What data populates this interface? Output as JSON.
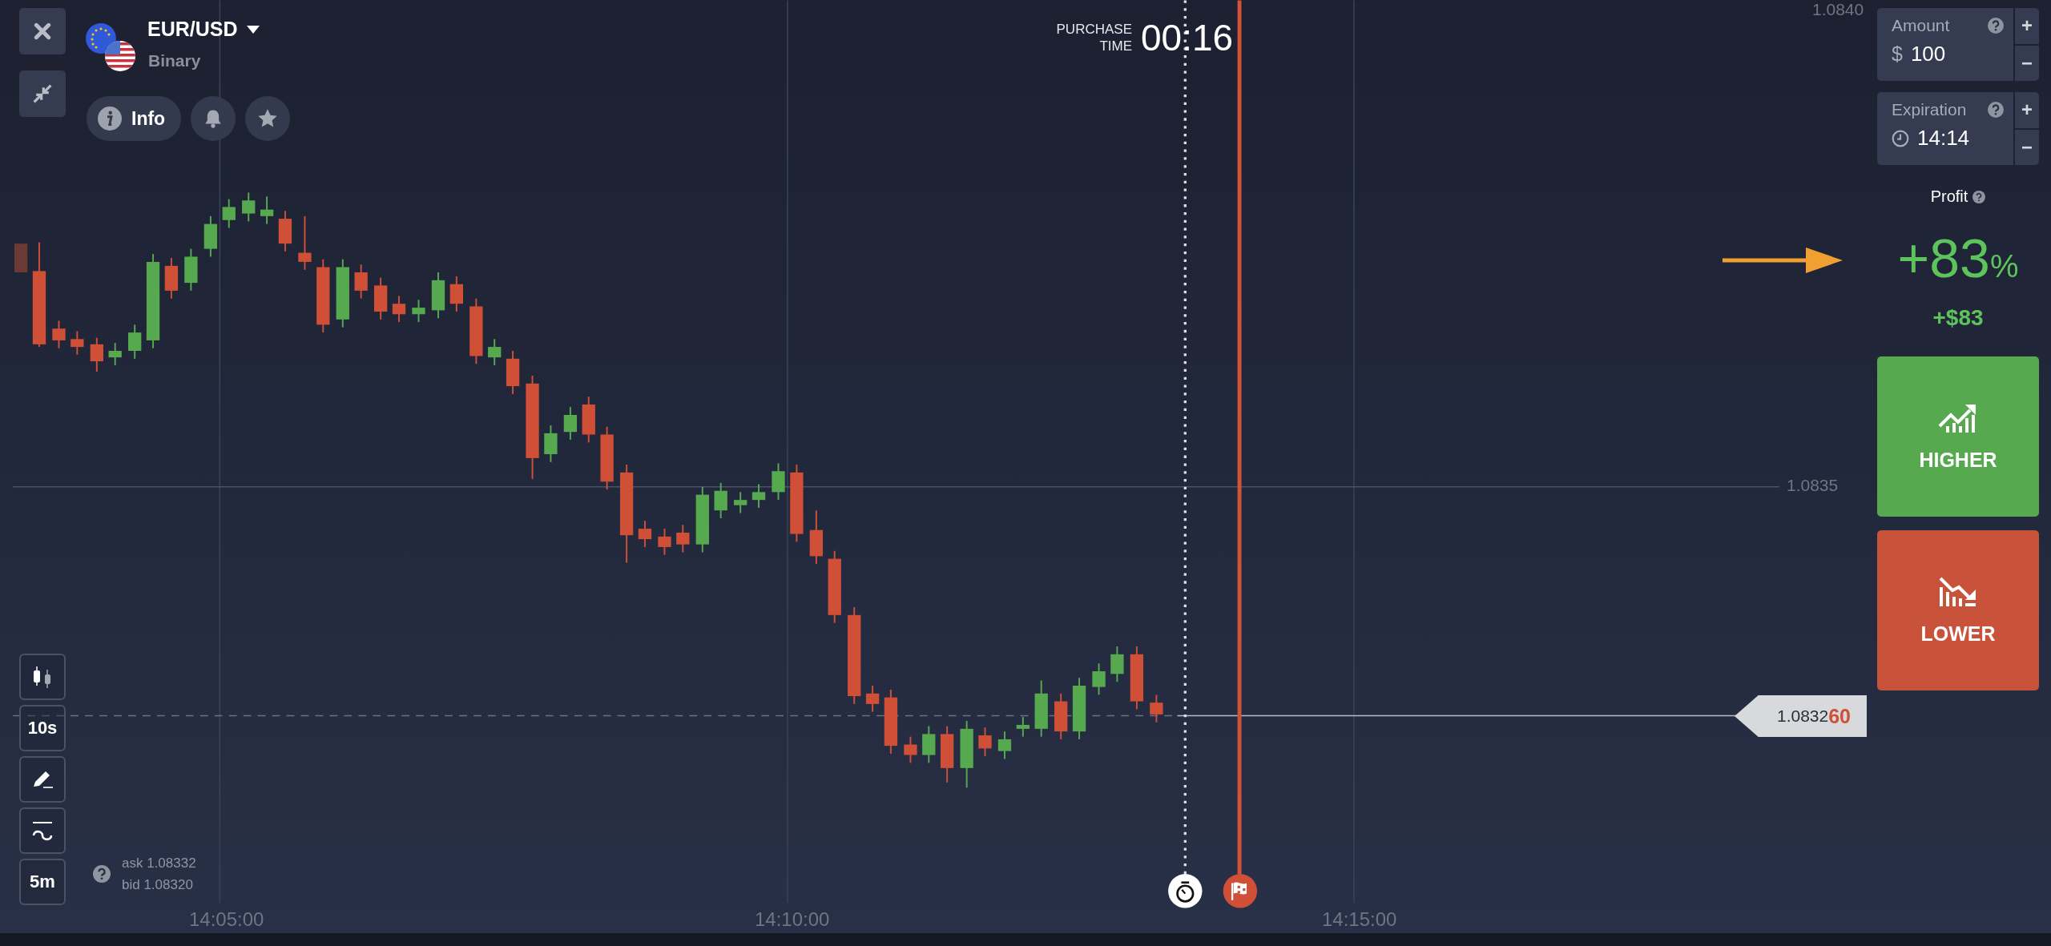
{
  "asset": {
    "name": "EUR/USD",
    "type": "Binary"
  },
  "asset_actions": [
    {
      "kind": "info",
      "label": "Info"
    },
    {
      "kind": "bell"
    },
    {
      "kind": "star"
    }
  ],
  "purchase_time": {
    "label": "PURCHASE TIME",
    "countdown": "00:16"
  },
  "chart": {
    "y_labels": [
      "1.0840",
      "1.0835"
    ],
    "x_labels": [
      "14:05:00",
      "14:10:00",
      "14:15:00"
    ],
    "current_price": "1.0832**60**"
  },
  "toolbar": [
    {
      "kind": "chart-type"
    },
    {
      "kind": "text",
      "label": "10s"
    },
    {
      "kind": "draw"
    },
    {
      "kind": "indicators"
    },
    {
      "kind": "text",
      "label": "5m"
    }
  ],
  "quote": {
    "ask": "ask 1.08332",
    "bid": "bid 1.08320"
  },
  "amount": {
    "label": "Amount",
    "currency": "$",
    "value": "100",
    "increment": "+",
    "decrement": "−"
  },
  "expiration": {
    "label": "Expiration",
    "value": "14:14",
    "increment": "+",
    "decrement": "−"
  },
  "profit": {
    "label": "Profit",
    "percent": "+83",
    "percent_sign": "%",
    "amount": "+$83"
  },
  "trade_buttons": [
    {
      "kind": "higher",
      "label": "HIGHER"
    },
    {
      "kind": "lower",
      "label": "LOWER"
    }
  ]
}
